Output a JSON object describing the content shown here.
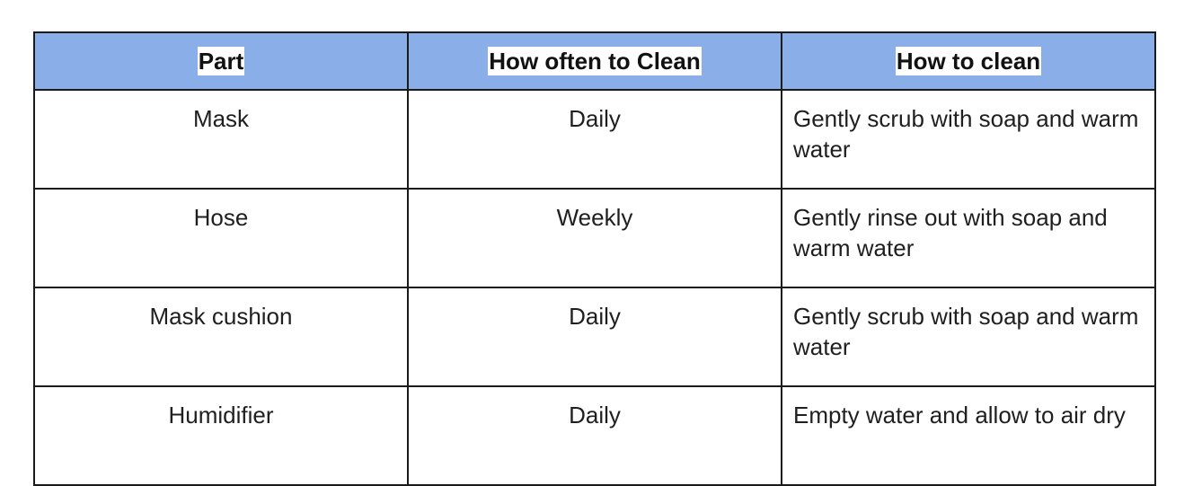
{
  "table": {
    "headers": [
      "Part",
      "How often to Clean",
      "How to clean"
    ],
    "rows": [
      {
        "part": "Mask",
        "frequency": "Daily",
        "method": "Gently scrub with soap and warm water"
      },
      {
        "part": "Hose",
        "frequency": "Weekly",
        "method": "Gently rinse out with soap and warm water"
      },
      {
        "part": "Mask cushion",
        "frequency": "Daily",
        "method": "Gently scrub with soap and warm water"
      },
      {
        "part": "Humidifier",
        "frequency": "Daily",
        "method": "Empty water and allow to air dry"
      }
    ]
  },
  "colors": {
    "header_background": "#8aaee8",
    "border": "#1a1a1a"
  }
}
